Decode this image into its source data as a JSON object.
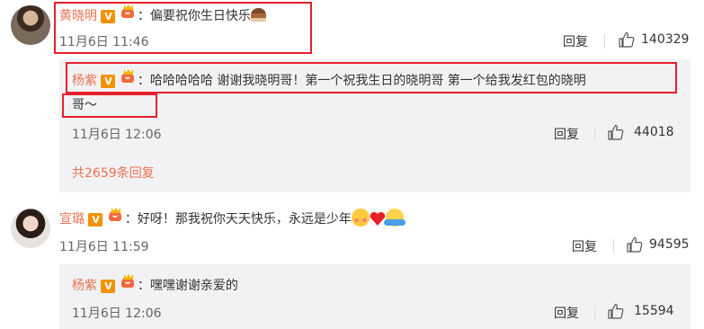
{
  "comments": [
    {
      "user": "黄晓明",
      "text": "偏要祝你生日快乐",
      "emoji": "cake-icon",
      "time": "11月6日 11:46",
      "reply_label": "回复",
      "likes": "140329",
      "replies": [
        {
          "user": "杨紫",
          "text_line1": "哈哈哈哈哈 谢谢我晓明哥！第一个祝我生日的晓明哥 第一个给我发红包的晓明",
          "text_line2": "哥～",
          "time": "11月6日 12:06",
          "reply_label": "回复",
          "likes": "44018"
        }
      ],
      "more_replies": "共2659条回复"
    },
    {
      "user": "宣璐",
      "text": "好呀！那我祝你天天快乐，永远是少年",
      "emojis": [
        "blush-icon",
        "heart-icon",
        "hug-icon"
      ],
      "time": "11月6日 11:59",
      "reply_label": "回复",
      "likes": "94595",
      "replies": [
        {
          "user": "杨紫",
          "text_line1": "嘿嘿谢谢亲爱的",
          "time": "11月6日 12:06",
          "reply_label": "回复",
          "likes": "15594"
        }
      ]
    }
  ],
  "badges": {
    "v": "V",
    "colon": "："
  },
  "colors": {
    "username": "#eb7350",
    "highlight": "#e8202a",
    "reply_bg": "#f2f2f5"
  }
}
